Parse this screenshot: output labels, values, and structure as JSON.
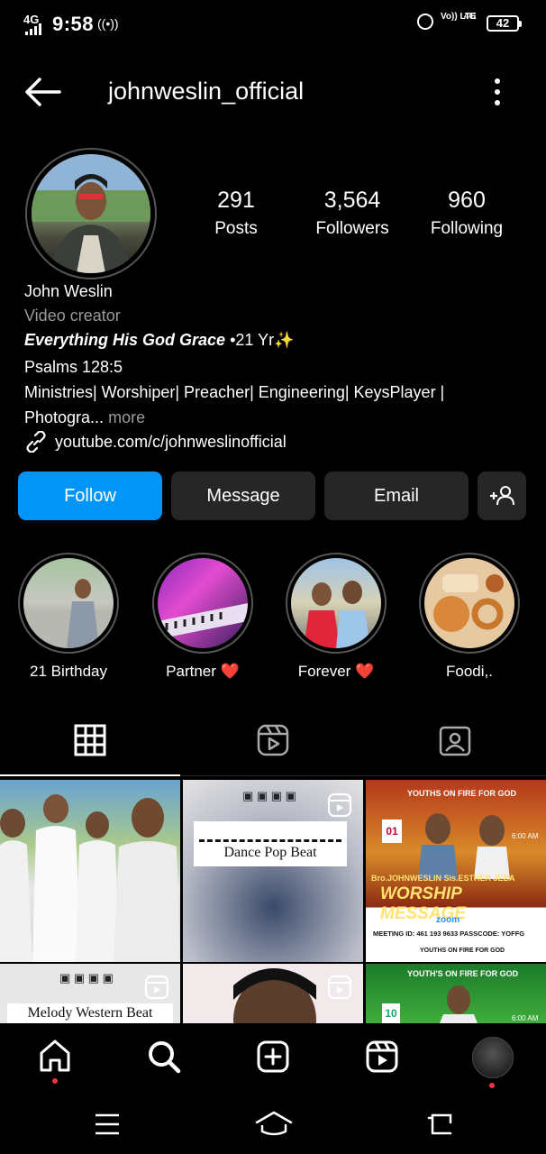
{
  "status": {
    "network": "4G",
    "time": "9:58",
    "volte": "Vo)) LTE",
    "net2": "4G",
    "battery": "42"
  },
  "header": {
    "username": "johnweslin_official"
  },
  "stats": [
    {
      "number": "291",
      "label": "Posts"
    },
    {
      "number": "3,564",
      "label": "Followers"
    },
    {
      "number": "960",
      "label": "Following"
    }
  ],
  "bio": {
    "name": "John Weslin",
    "category": "Video creator",
    "line1_bold": "Everything His God Grace",
    "line1_rest": " •21 Yr✨",
    "line2": "Psalms 128:5",
    "line3": "Ministries| Worshiper| Preacher| Engineering| KeysPlayer |",
    "line4": "Photogra...",
    "more": "more",
    "link": "youtube.com/c/johnweslinofficial"
  },
  "buttons": {
    "follow": "Follow",
    "message": "Message",
    "email": "Email"
  },
  "highlights": [
    {
      "label": "21 Birthday"
    },
    {
      "label": "Partner ❤️"
    },
    {
      "label": "Forever ❤️"
    },
    {
      "label": "Foodi,."
    }
  ],
  "grid": {
    "tile2_text": "Dance Pop Beat",
    "tile3_brand": "YOUTHS ON FIRE FOR GOD",
    "tile3_date": "01",
    "tile3_time": "6:00 AM",
    "tile3_names": "Bro.JOHNWESLIN  Sis.ESTHER JEBA",
    "tile3_title": "WORSHIP MESSAGE",
    "tile3_zoom": "zoom",
    "tile3_meeting": "MEETING ID: 461 193 9633  PASSCODE: YOFFG",
    "tile3_footer": "YOUTHS ON FIRE FOR GOD",
    "tile4_text": "Melody Western Beat",
    "tile6_brand": "YOUTH'S ON FIRE FOR GOD",
    "tile6_date": "10",
    "tile6_time": "6:00 AM"
  },
  "colors": {
    "accent": "#0095f6",
    "button_bg": "#262626",
    "notify": "#ff3040"
  }
}
